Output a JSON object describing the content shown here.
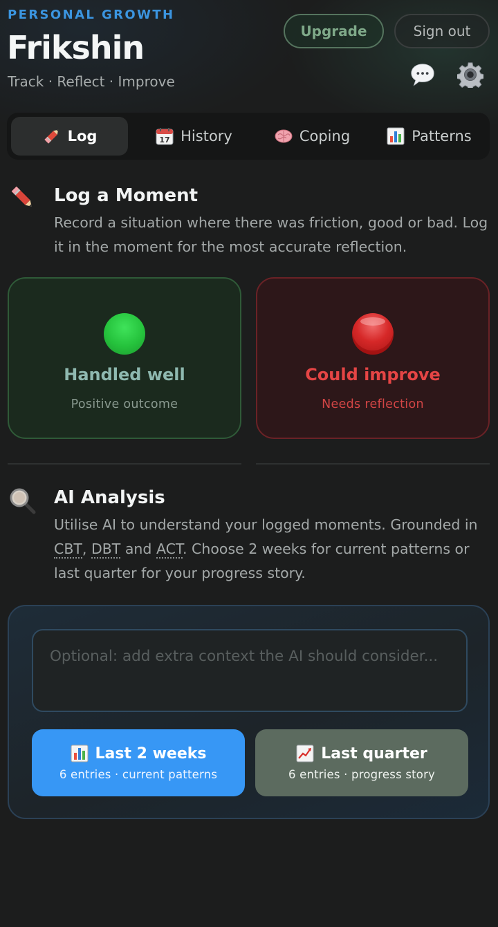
{
  "header": {
    "eyebrow": "PERSONAL GROWTH",
    "title": "Frikshin",
    "tagline": "Track · Reflect · Improve",
    "upgrade_label": "Upgrade",
    "signout_label": "Sign out"
  },
  "tabs": [
    {
      "label": "Log",
      "icon": "pencil-icon",
      "active": true
    },
    {
      "label": "History",
      "icon": "calendar-icon",
      "active": false
    },
    {
      "label": "Coping",
      "icon": "brain-icon",
      "active": false
    },
    {
      "label": "Patterns",
      "icon": "bar-chart-icon",
      "active": false
    }
  ],
  "log_section": {
    "title": "Log a Moment",
    "description": "Record a situation where there was friction, good or bad. Log it in the moment for the most accurate reflection.",
    "icon": "pencil-icon"
  },
  "outcomes": [
    {
      "title": "Handled well",
      "subtitle": "Positive outcome",
      "color": "#25c23c"
    },
    {
      "title": "Could improve",
      "subtitle": "Needs reflection",
      "color": "#d62828"
    }
  ],
  "ai_section": {
    "title": "AI Analysis",
    "icon": "magnifier-icon",
    "desc_part1": "Utilise AI to understand your logged moments. Grounded in ",
    "abbr1": "CBT",
    "sep1": ", ",
    "abbr2": "DBT",
    "sep2": " and ",
    "abbr3": "ACT",
    "desc_part2": ". Choose 2 weeks for current patterns or last quarter for your progress story.",
    "context_placeholder": "Optional: add extra context the AI should consider...",
    "buttons": [
      {
        "title": "Last 2 weeks",
        "subtitle": "6 entries · current patterns",
        "icon": "bar-chart-icon",
        "color": "#3797f5"
      },
      {
        "title": "Last quarter",
        "subtitle": "6 entries · progress story",
        "icon": "trend-up-icon",
        "color": "#5c6b5f"
      }
    ]
  },
  "colors": {
    "accent_blue": "#3b95e0",
    "background": "#1c1d1d"
  }
}
